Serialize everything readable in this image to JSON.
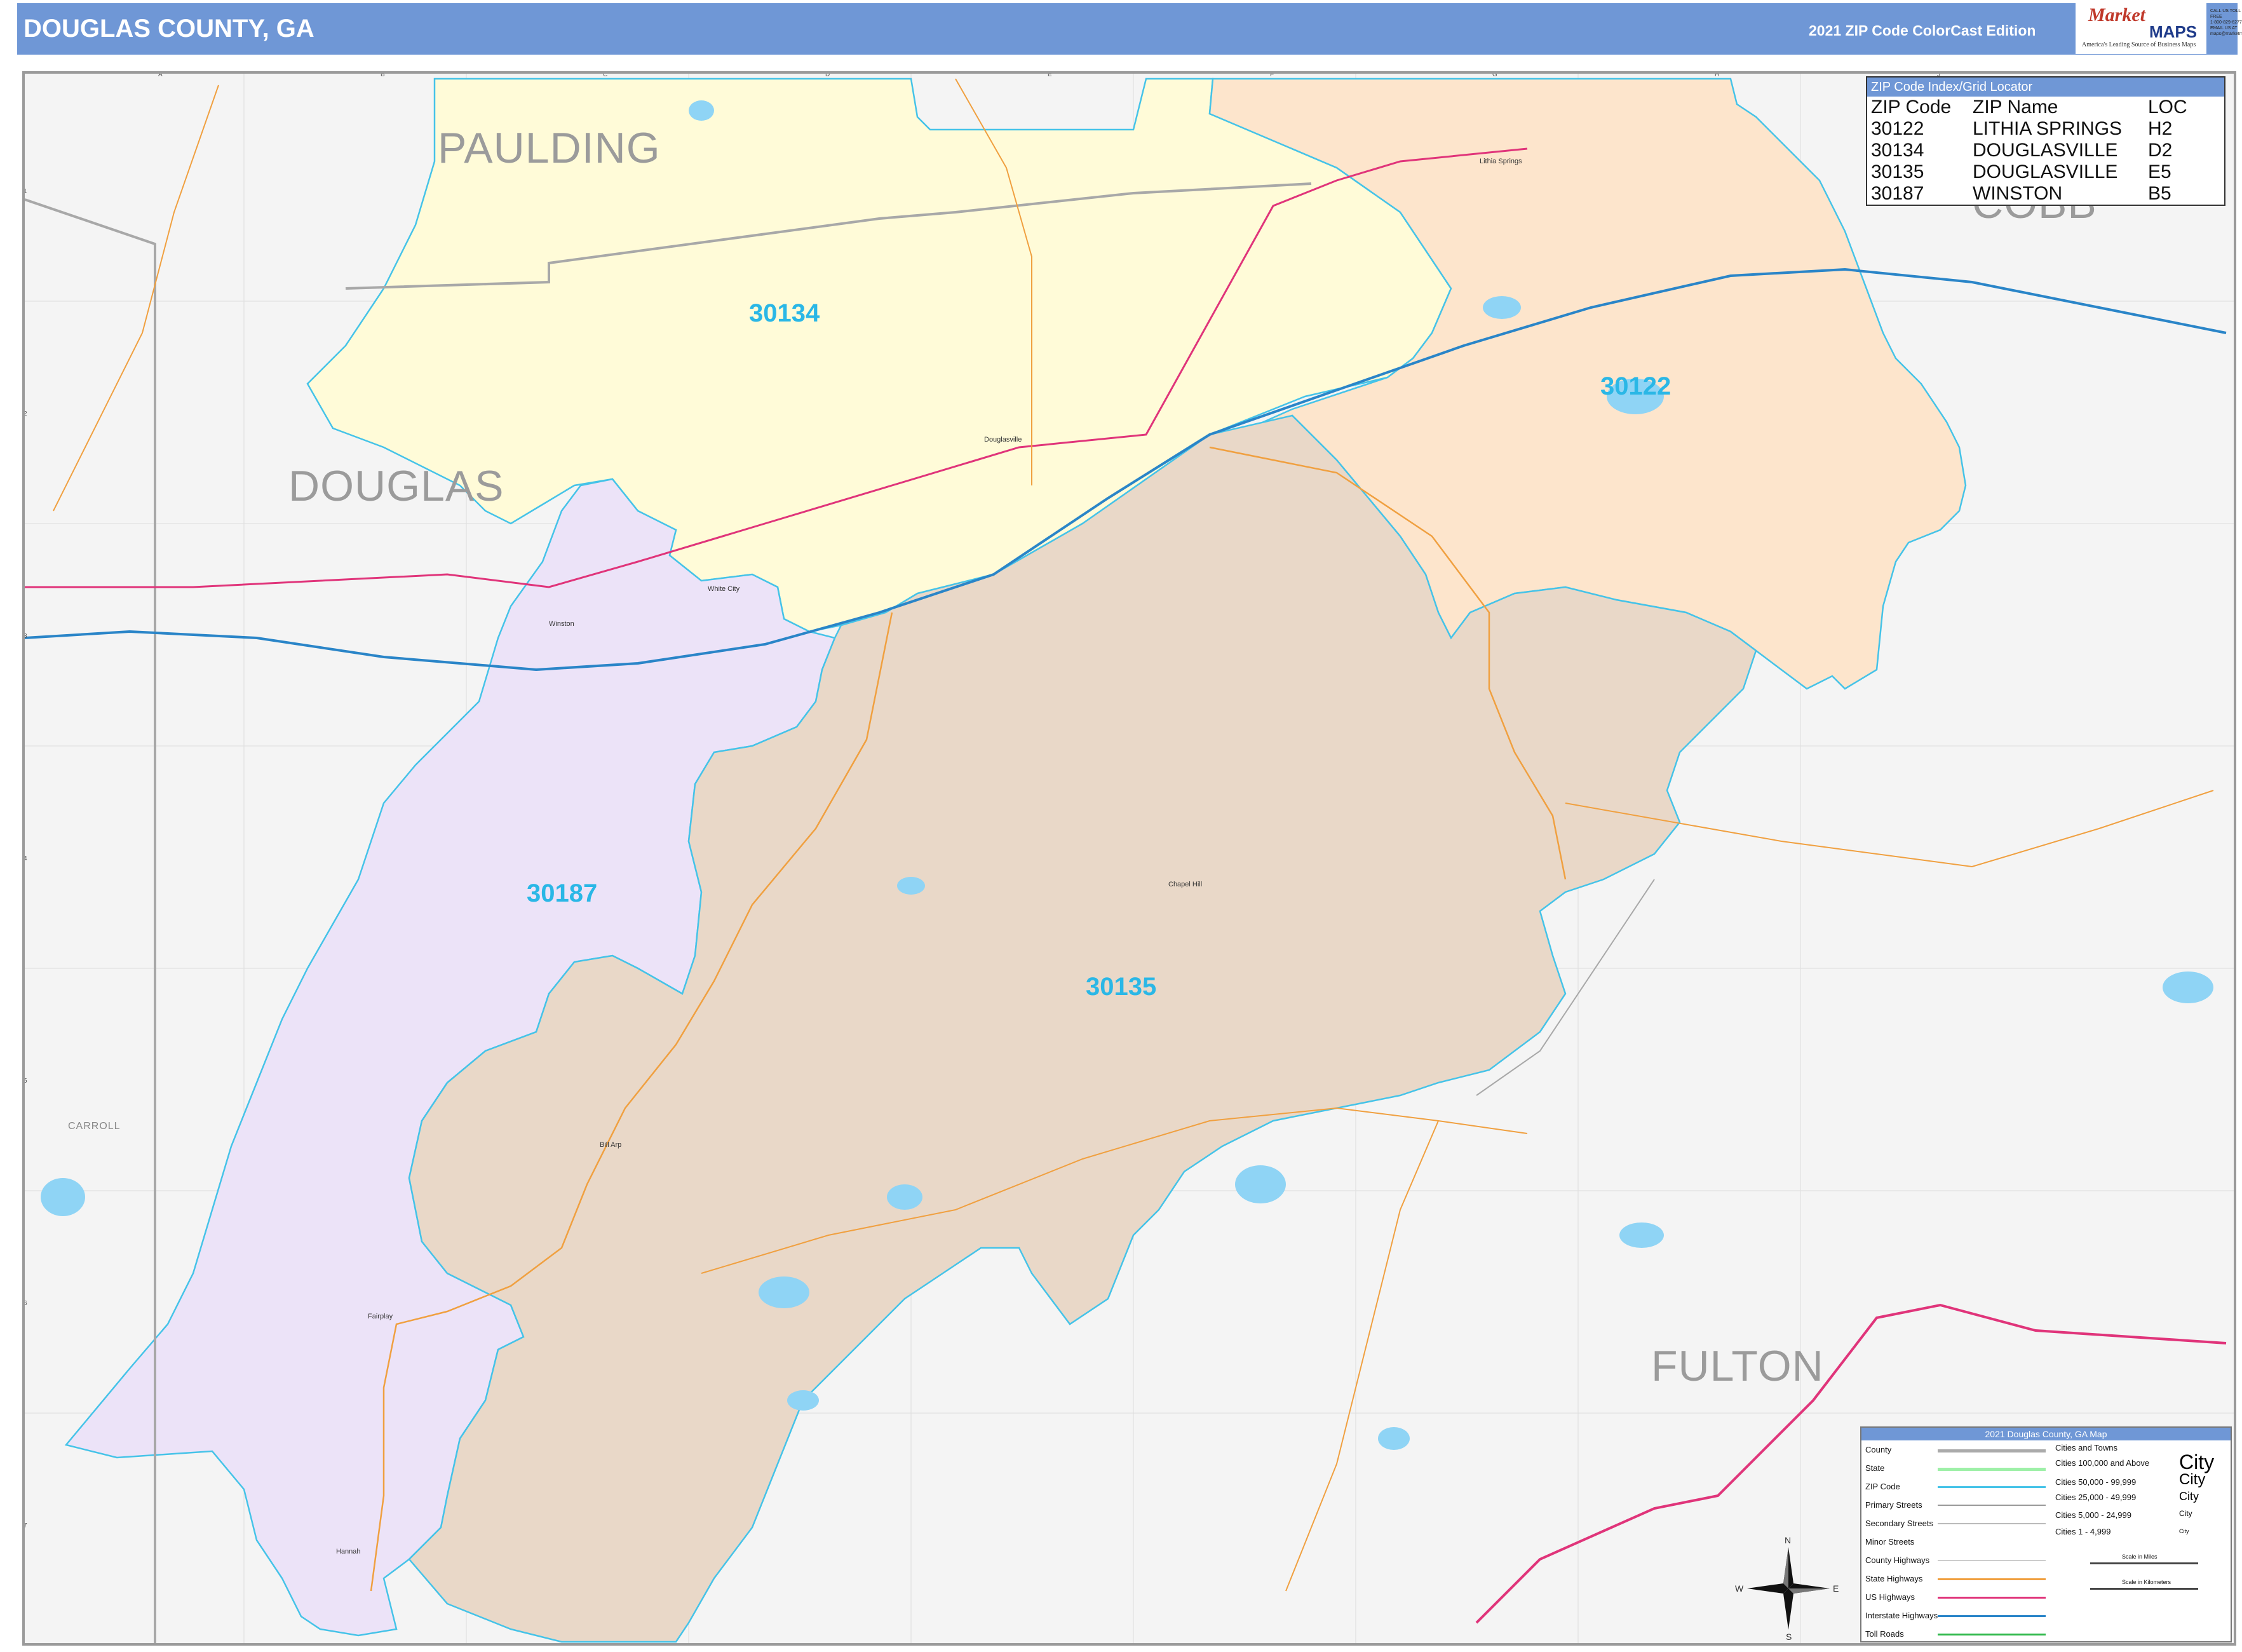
{
  "header": {
    "title": "DOUGLAS COUNTY, GA",
    "edition": "2021 ZIP Code ColorCast Edition",
    "logo_name": "Market",
    "logo_maps": "MAPS",
    "logo_tagline": "America's Leading Source of Business Maps",
    "contact": [
      "CALL US TOLL FREE",
      "1-800-829-6277",
      "EMAIL US AT",
      "maps@marketmaps.com"
    ]
  },
  "counties": {
    "paulding": "PAULDING",
    "douglas": "DOUGLAS",
    "cobb": "COBB",
    "fulton": "FULTON",
    "carroll": "CARROLL"
  },
  "zip_areas": [
    {
      "zip": "30134",
      "name": "DOUGLASVILLE",
      "color": "#fffbd8"
    },
    {
      "zip": "30122",
      "name": "LITHIA SPRINGS",
      "color": "#fde5cc"
    },
    {
      "zip": "30187",
      "name": "WINSTON",
      "color": "#ece3f8"
    },
    {
      "zip": "30135",
      "name": "DOUGLASVILLE",
      "color": "#e9d8c8"
    }
  ],
  "places": {
    "douglasville": "Douglasville",
    "lithia_springs": "Lithia Springs",
    "winston": "Winston",
    "white_city": "White City",
    "chapel_hill": "Chapel Hill",
    "bill_arp": "Bill Arp",
    "fairplay": "Fairplay",
    "hannah": "Hannah"
  },
  "grid": {
    "columns": [
      "A",
      "B",
      "C",
      "D",
      "E",
      "F",
      "G",
      "H",
      "J"
    ],
    "rows": [
      "1",
      "2",
      "3",
      "4",
      "5",
      "6",
      "7"
    ]
  },
  "zip_index": {
    "title": "ZIP Code Index/Grid Locator",
    "headers": [
      "ZIP Code",
      "ZIP Name",
      "LOC"
    ],
    "rows": [
      [
        "30122",
        "LITHIA SPRINGS",
        "H2"
      ],
      [
        "30134",
        "DOUGLASVILLE",
        "D2"
      ],
      [
        "30135",
        "DOUGLASVILLE",
        "E5"
      ],
      [
        "30187",
        "WINSTON",
        "B5"
      ]
    ]
  },
  "legend": {
    "title": "2021 Douglas County, GA Map",
    "items": [
      "County",
      "State",
      "ZIP Code",
      "Primary Streets",
      "Secondary Streets",
      "Minor Streets",
      "County Highways",
      "State Highways",
      "US Highways",
      "Interstate Highways",
      "Toll Roads"
    ],
    "city_header": "Cities and Towns",
    "city_classes": [
      "Cities 100,000 and Above",
      "Cities 50,000 - 99,999",
      "Cities 25,000 - 49,999",
      "Cities 5,000 - 24,999",
      "Cities 1 - 4,999"
    ],
    "city_sample": "City",
    "scale_miles": "Scale in Miles",
    "scale_km": "Scale in Kilometers",
    "colors": {
      "county": "#aaaaaa",
      "state": "#9ef0a8",
      "zip": "#45c3e8",
      "primary": "#999999",
      "secondary": "#bbbbbb",
      "state_hwy": "#f0a040",
      "us_hwy": "#e0347a",
      "interstate": "#2a85c8",
      "toll": "#2fb84a"
    }
  },
  "compass": {
    "n": "N",
    "s": "S",
    "e": "E",
    "w": "W"
  }
}
